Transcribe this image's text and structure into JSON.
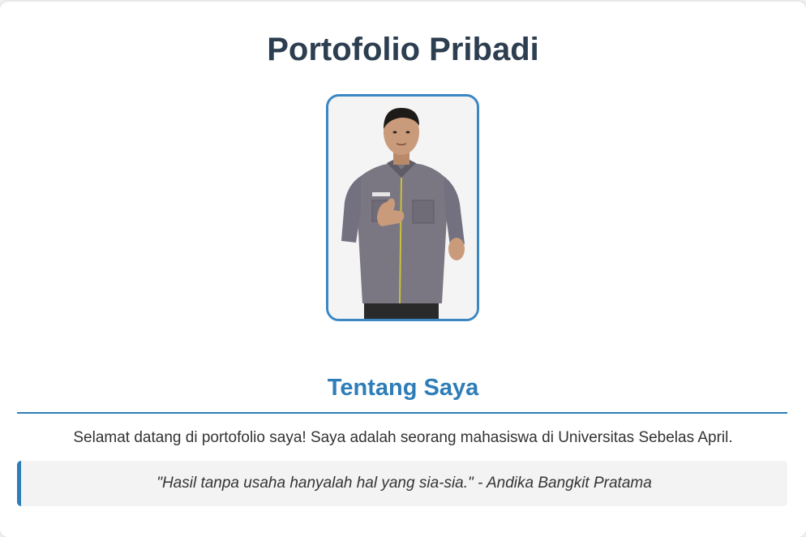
{
  "page": {
    "title": "Portofolio Pribadi"
  },
  "profile": {
    "photo_icon": "person-photo",
    "frame_color": "#3b87c4"
  },
  "about": {
    "heading": "Tentang Saya",
    "intro": "Selamat datang di portofolio saya! Saya adalah seorang mahasiswa di Universitas Sebelas April.",
    "quote": "\"Hasil tanpa usaha hanyalah hal yang sia-sia.\" - Andika Bangkit Pratama"
  },
  "colors": {
    "title": "#2c3e50",
    "accent": "#2e7db8",
    "quote_bg": "#f3f3f3"
  }
}
